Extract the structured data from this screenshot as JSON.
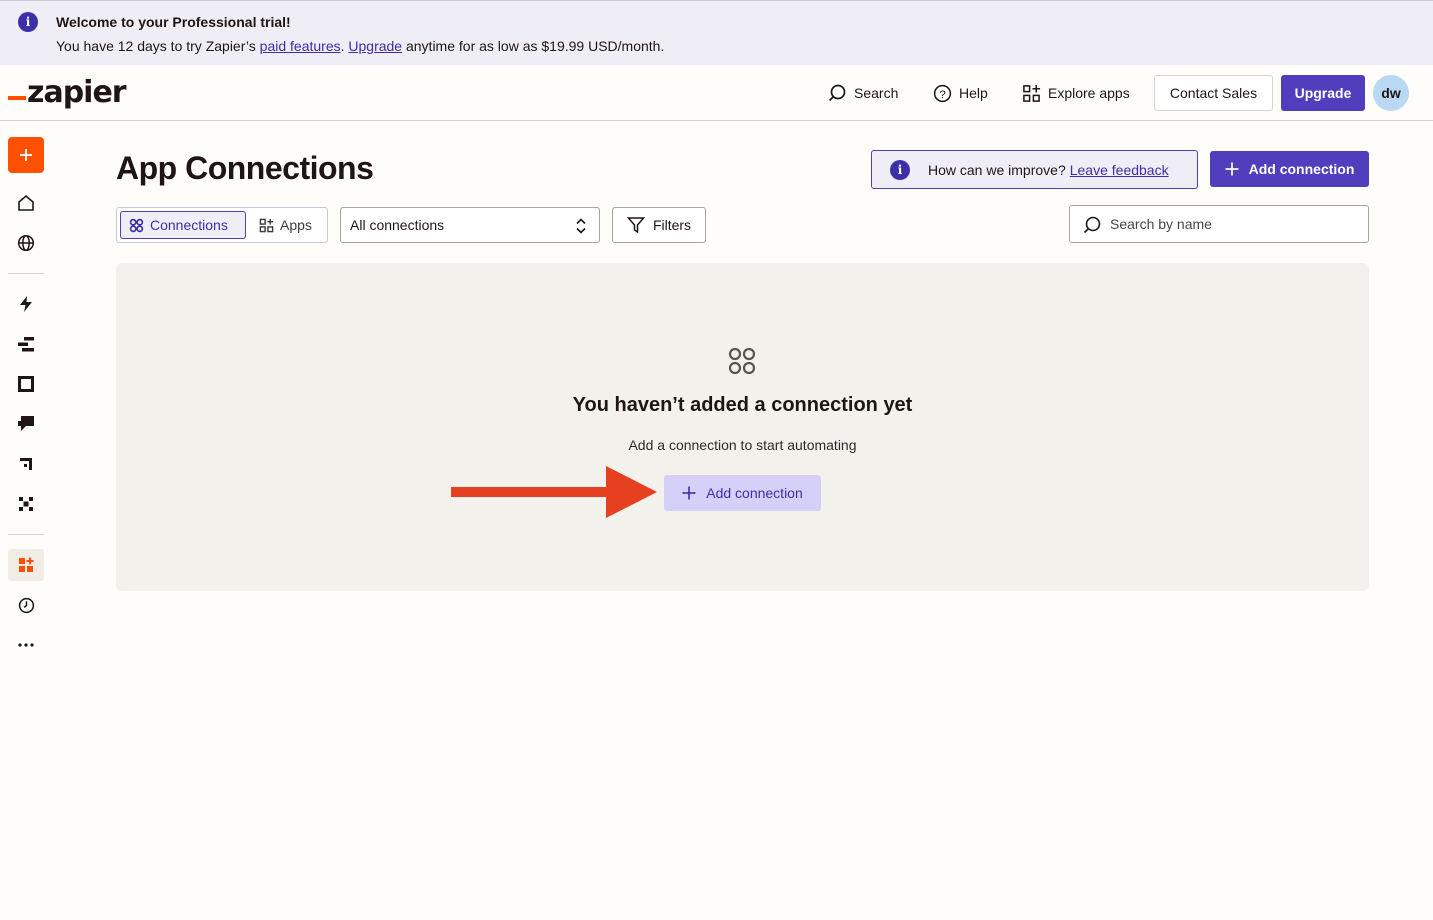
{
  "banner": {
    "title": "Welcome to your Professional trial!",
    "text_1": "You have 12 days to try Zapier’s ",
    "link_paid": "paid features",
    "text_2": ". ",
    "link_upgrade": "Upgrade",
    "text_3": " anytime for as low as $19.99 USD/month."
  },
  "header": {
    "logo": "zapier",
    "search": "Search",
    "help": "Help",
    "explore": "Explore apps",
    "contact": "Contact Sales",
    "upgrade": "Upgrade",
    "avatar": "dw"
  },
  "main": {
    "title": "App Connections",
    "feedback_text": "How can we improve?",
    "feedback_link": "Leave feedback",
    "add_connection": "Add connection",
    "tabs": [
      "Connections",
      "Apps"
    ],
    "select_value": "All connections",
    "filters": "Filters",
    "search_placeholder": "Search by name"
  },
  "empty": {
    "title": "You haven’t added a connection yet",
    "subtitle": "Add a connection to start automating",
    "button": "Add connection"
  },
  "colors": {
    "brand_orange": "#ff4f00",
    "primary_purple": "#503ebd",
    "annotation_arrow": "#e5401f"
  }
}
